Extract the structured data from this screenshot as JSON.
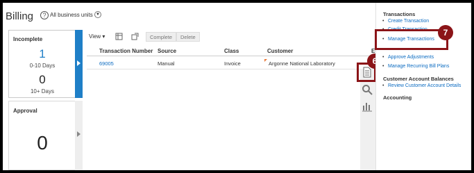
{
  "header": {
    "title": "Billing",
    "business_unit_selector": "All business units"
  },
  "cards": {
    "incomplete": {
      "label": "Incomplete",
      "first_count": "1",
      "first_label": "0-10 Days",
      "second_count": "0",
      "second_label": "10+ Days"
    },
    "approval": {
      "label": "Approval",
      "count": "0"
    }
  },
  "toolbar": {
    "view_label": "View",
    "complete_label": "Complete",
    "delete_label": "Delete"
  },
  "table": {
    "columns": [
      "Transaction Number",
      "Source",
      "Class",
      "Customer",
      "En"
    ],
    "rows": [
      {
        "transaction_number": "69005",
        "source": "Manual",
        "class": "Invoice",
        "customer": "Argonne National Laboratory"
      }
    ]
  },
  "tasks_panel": {
    "transactions_title": "Transactions",
    "transactions": [
      "Create Transaction",
      "Credit Transaction",
      "Manage Transactions",
      "Approve Adjustments",
      "Manage Recurring Bill Plans"
    ],
    "customer_balances_title": "Customer Account Balances",
    "customer_balances": [
      "Review Customer Account Details"
    ],
    "accounting_title": "Accounting"
  },
  "callouts": {
    "step_6": "6",
    "step_7": "7"
  },
  "colors": {
    "accent_blue": "#1f7fc7",
    "link_blue": "#0b6bc1",
    "callout_red": "#8b1418"
  },
  "icons": [
    "help-icon",
    "chevron-down-icon",
    "freeze-columns-icon",
    "detach-icon",
    "tasks-icon",
    "search-icon",
    "reports-icon"
  ]
}
